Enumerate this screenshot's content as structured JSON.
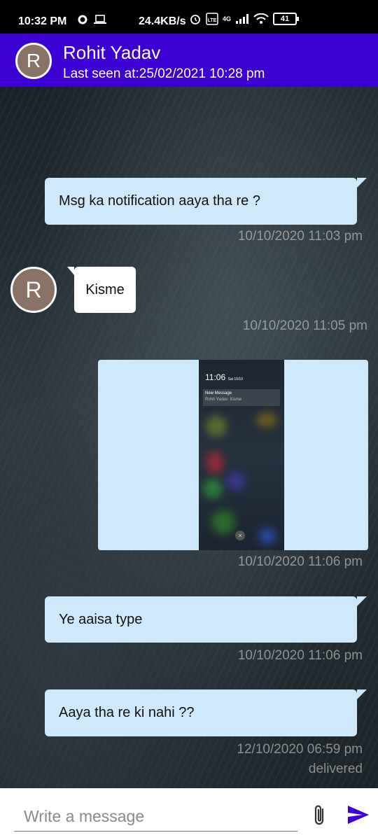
{
  "status_bar": {
    "time": "10:32 PM",
    "speed": "24.4KB/s",
    "network_label": "4G",
    "battery": "41"
  },
  "header": {
    "avatar_initial": "R",
    "name": "Rohit Yadav",
    "last_seen": "Last seen at:25/02/2021 10:28 pm"
  },
  "messages": [
    {
      "direction": "out",
      "text": "Msg ka notification aaya tha re ?",
      "time": "10/10/2020 11:03 pm"
    },
    {
      "direction": "in",
      "avatar_initial": "R",
      "text": "Kisme",
      "time": "10/10/2020 11:05 pm"
    },
    {
      "direction": "out",
      "type": "image",
      "time": "10/10/2020 11:06 pm",
      "image_content": {
        "time": "11:06",
        "date": "Sat 10/10",
        "notif_title": "New Message",
        "notif_body": "Rohit Yadav: Kisme"
      }
    },
    {
      "direction": "out",
      "text": "Ye aaisa type",
      "time": "10/10/2020 11:06 pm"
    },
    {
      "direction": "out",
      "text": "Aaya tha re ki nahi ??",
      "time": "12/10/2020 06:59 pm",
      "status": "delivered"
    }
  ],
  "composer": {
    "placeholder": "Write a message",
    "attach_icon": "paperclip-icon",
    "send_icon": "send-icon"
  },
  "colors": {
    "toolbar": "#3d00d4",
    "outgoing_bubble": "#cde9fb",
    "incoming_bubble": "#ffffff",
    "avatar": "#8a7267",
    "send": "#3d00d4"
  }
}
